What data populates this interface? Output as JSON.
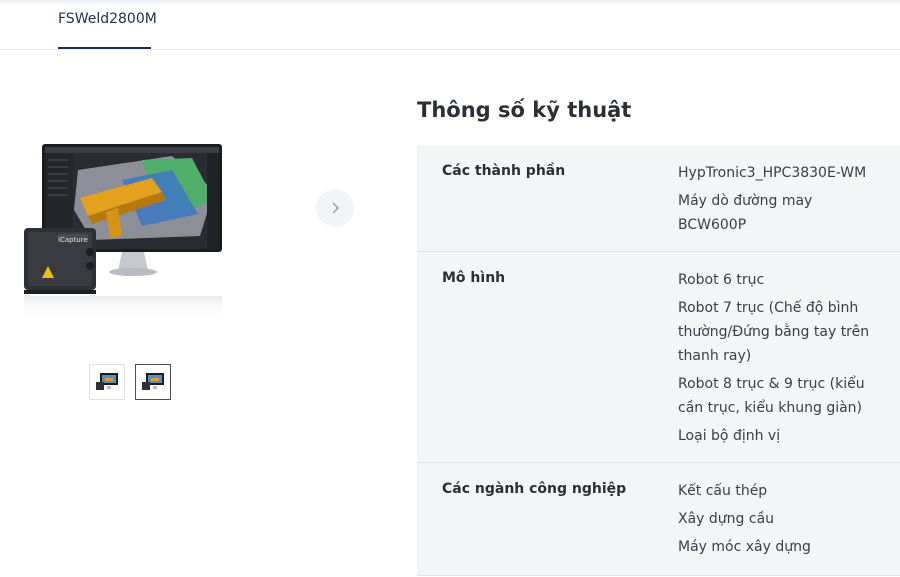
{
  "tab": {
    "label": "FSWeld2800M"
  },
  "gallery": {
    "device_label": "iCapture",
    "thumb_count": 2,
    "active_thumb": 1
  },
  "spec": {
    "title": "Thông số kỹ thuật",
    "rows": [
      {
        "label": "Các thành phần",
        "values": [
          "HypTronic3_HPC3830E-WM",
          "Máy dò đường may BCW600P"
        ]
      },
      {
        "label": "Mô hình",
        "values": [
          "Robot 6 trục",
          "Robot 7 trục (Chế độ bình thường/Đứng bằng tay trên thanh ray)",
          "Robot 8 trục & 9 trục (kiểu cần trục, kiểu khung giàn)",
          "Loại bộ định vị"
        ]
      },
      {
        "label": "Các ngành công nghiệp",
        "values": [
          "Kết cấu thép",
          "Xây dựng cầu",
          "Máy móc xây dựng"
        ]
      }
    ]
  },
  "colors": {
    "accent": "#1c2f57",
    "row_bg": "#f3f5f7"
  }
}
